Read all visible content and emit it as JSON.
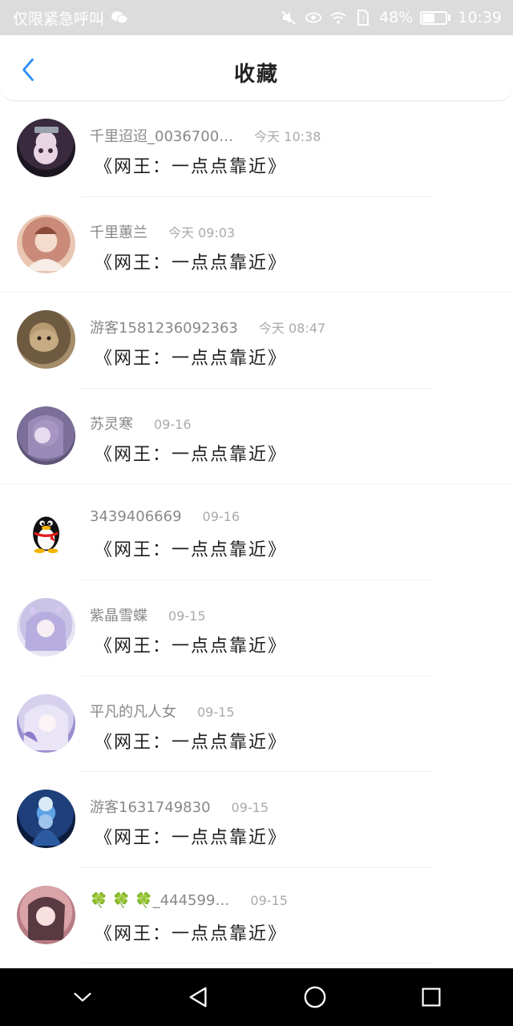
{
  "status_bar": {
    "carrier": "仅限紧急呼叫",
    "battery_percent": "48%",
    "battery_level": 0.48,
    "time": "10:39",
    "icons": [
      "wechat-icon",
      "mute-icon",
      "eye-icon",
      "wifi-icon",
      "sim-icon",
      "battery-icon"
    ]
  },
  "header": {
    "title": "收藏",
    "back_icon": "chevron-left-icon",
    "accent": "#2b8ef5"
  },
  "favorites": [
    {
      "user": "千里迢迢_0036700…",
      "time": "今天 10:38",
      "book": "《网王：一点点靠近》",
      "avatar_color": "#3a2a3e"
    },
    {
      "user": "千里蕙兰",
      "time": "今天 09:03",
      "book": "《网王：一点点靠近》",
      "avatar_color": "#c98a7a"
    },
    {
      "user": "游客1581236092363",
      "time": "今天 08:47",
      "book": "《网王：一点点靠近》",
      "avatar_color": "#8a7356"
    },
    {
      "user": "苏灵寒",
      "time": "09-16",
      "book": "《网王：一点点靠近》",
      "avatar_color": "#7b6f9a"
    },
    {
      "user": "3439406669",
      "time": "09-16",
      "book": "《网王：一点点靠近》",
      "avatar_color": "#ffffff"
    },
    {
      "user": "紫晶雪蝶",
      "time": "09-15",
      "book": "《网王：一点点靠近》",
      "avatar_color": "#c9c3e6"
    },
    {
      "user": "平凡的凡人女",
      "time": "09-15",
      "book": "《网王：一点点靠近》",
      "avatar_color": "#d6d0ee"
    },
    {
      "user": "游客1631749830",
      "time": "09-15",
      "book": "《网王：一点点靠近》",
      "avatar_color": "#1e3f7a"
    },
    {
      "user": "🍀 🍀 🍀_444599…",
      "time": "09-15",
      "book": "《网王：一点点靠近》",
      "avatar_color": "#d9a3a8"
    }
  ],
  "nav_bar": {
    "icons": [
      "collapse-icon",
      "back-triangle-icon",
      "home-circle-icon",
      "recent-square-icon"
    ]
  }
}
